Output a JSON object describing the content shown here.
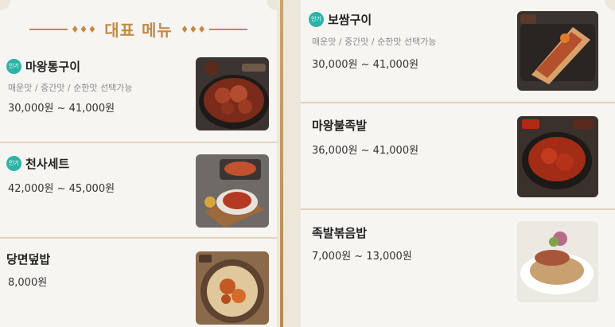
{
  "header": {
    "title": "대표 메뉴",
    "deco_dots": "♦♦♦"
  },
  "badge_label": "인기",
  "left_items": [
    {
      "name": "마왕통구이",
      "popular": true,
      "options": "매운맛 / 중간맛 / 순한맛 선택가능",
      "price": "30,000원 ~ 41,000원",
      "icon": "grilled-pork-photo"
    },
    {
      "name": "천사세트",
      "popular": true,
      "options": "",
      "price": "42,000원 ~ 45,000원",
      "icon": "set-meal-photo"
    },
    {
      "name": "당면덮밥",
      "popular": false,
      "options": "",
      "price": "8,000원",
      "icon": "rice-bowl-photo"
    }
  ],
  "right_items": [
    {
      "name": "보쌈구이",
      "popular": true,
      "options": "매운맛 / 중간맛 / 순한맛 선택가능",
      "price": "30,000원 ~ 41,000원",
      "icon": "bossam-photo"
    },
    {
      "name": "마왕불족발",
      "popular": false,
      "options": "",
      "price": "36,000원 ~ 41,000원",
      "icon": "fire-jokbal-photo"
    },
    {
      "name": "족발볶음밥",
      "popular": false,
      "options": "",
      "price": "7,000원 ~ 13,000원",
      "icon": "fried-rice-photo"
    }
  ],
  "colors": {
    "accent_gold": "#c08a4a",
    "badge_teal": "#2bb3a8",
    "separator": "#e3d2bb"
  }
}
